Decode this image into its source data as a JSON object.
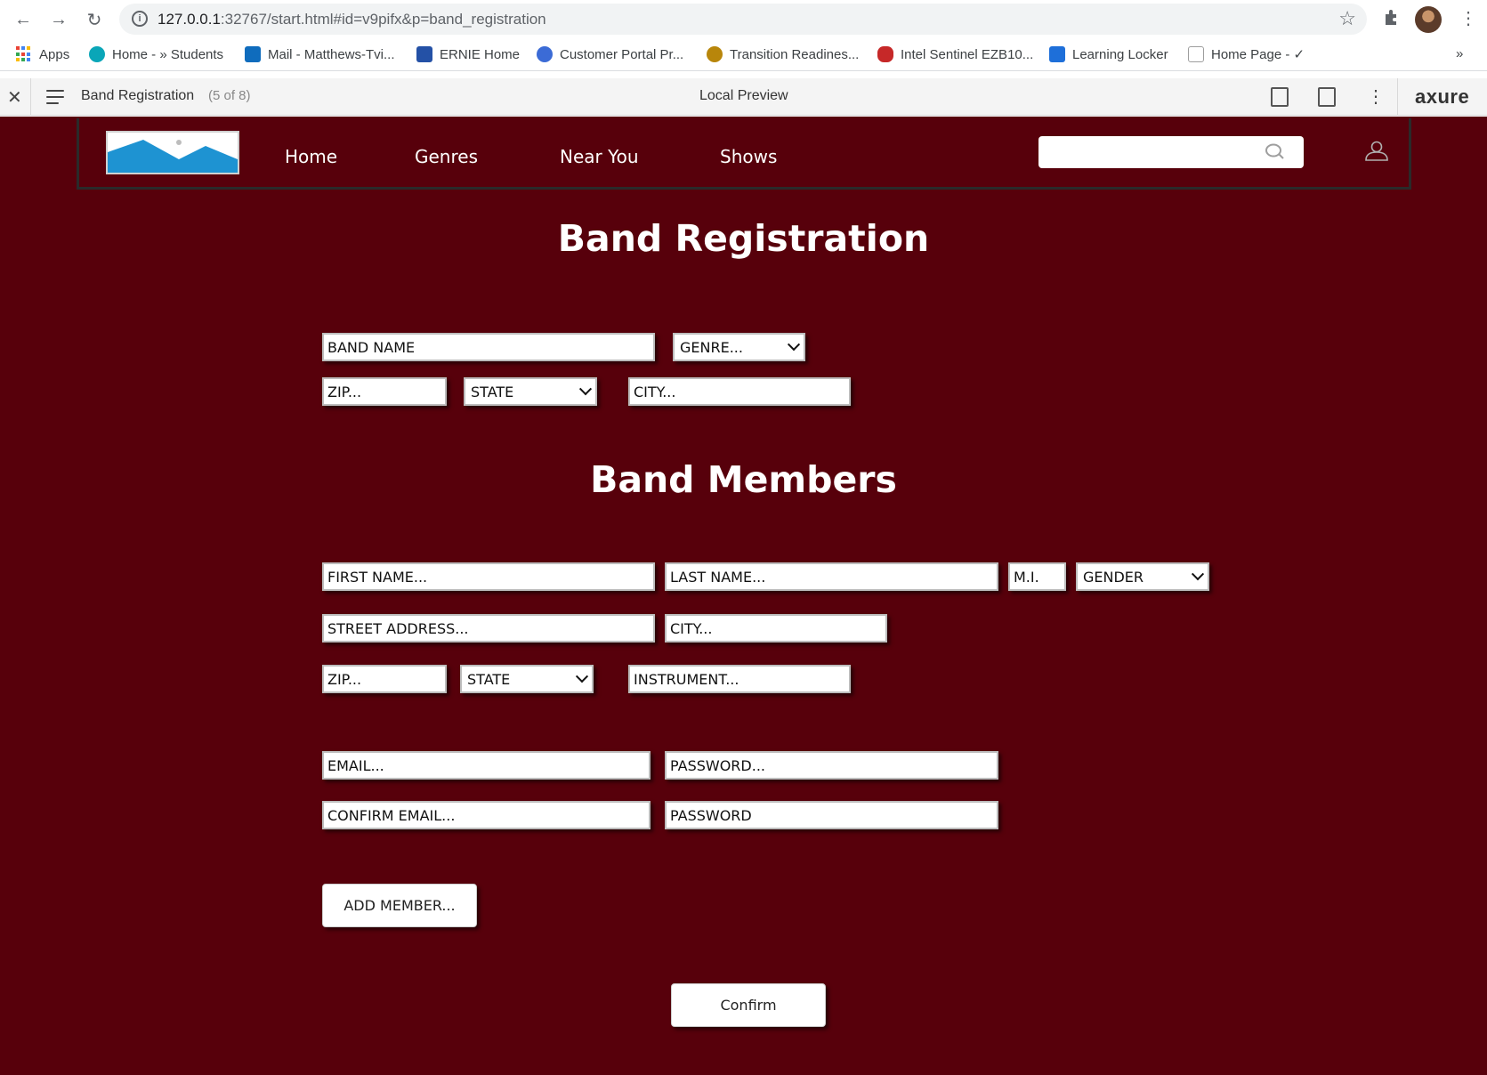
{
  "browser": {
    "url_host": "127.0.0.1",
    "url_rest": ":32767/start.html#id=v9pifx&p=band_registration",
    "bookmarks": [
      {
        "label": "Apps",
        "icon": "apps-grid-icon"
      },
      {
        "label": "Home - » Students",
        "icon": "students-icon",
        "color": "#0aa6b8"
      },
      {
        "label": "Mail - Matthews-Tvi...",
        "icon": "outlook-icon",
        "color": "#0f6cbd"
      },
      {
        "label": "ERNIE Home",
        "icon": "ernie-icon",
        "color": "#2451a6"
      },
      {
        "label": "Customer Portal Pr...",
        "icon": "portal-icon",
        "color": "#3b6bd6"
      },
      {
        "label": "Transition Readines...",
        "icon": "emblem-icon",
        "color": "#b8860b"
      },
      {
        "label": "Intel Sentinel EZB10...",
        "icon": "sentinel-icon",
        "color": "#c62828"
      },
      {
        "label": "Learning Locker",
        "icon": "ml-icon",
        "color": "#1e6fd9"
      },
      {
        "label": "Home Page - ✓",
        "icon": "doc-icon",
        "color": "#9e9e9e"
      }
    ],
    "overflow": "»"
  },
  "axure": {
    "page_title": "Band Registration",
    "page_count": "(5 of 8)",
    "mode": "Local Preview",
    "brand": "axure"
  },
  "site": {
    "nav": [
      "Home",
      "Genres",
      "Near You",
      "Shows"
    ],
    "search_value": ""
  },
  "form": {
    "title": "Band Registration",
    "band_name": "BAND NAME",
    "genre": "GENRE...",
    "zip": "ZIP...",
    "state": "STATE",
    "city": "CITY..."
  },
  "members": {
    "title": "Band Members",
    "first_name": "FIRST NAME...",
    "last_name": "LAST NAME...",
    "mi": "M.I.",
    "gender": "GENDER",
    "street": "STREET ADDRESS...",
    "city": "CITY...",
    "zip": "ZIP...",
    "state": "STATE",
    "instrument": "INSTRUMENT...",
    "email": "EMAIL...",
    "password": "PASSWORD...",
    "confirm_email": "CONFIRM EMAIL...",
    "confirm_password": "PASSWORD",
    "add_member": "ADD MEMBER...",
    "confirm": "Confirm"
  },
  "colors": {
    "page_bg": "#57000b",
    "logo_mountain": "#1e93d2"
  }
}
